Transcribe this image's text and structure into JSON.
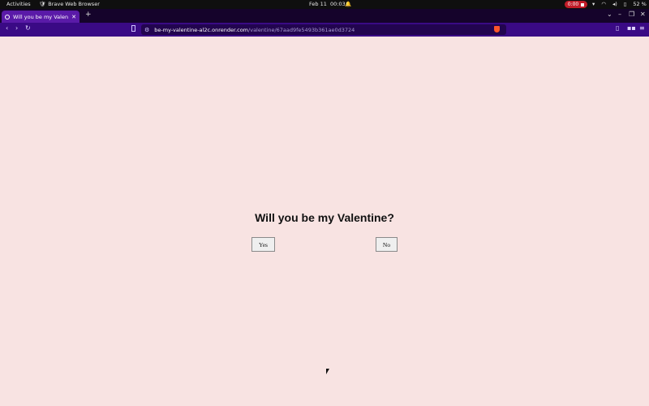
{
  "system_bar": {
    "activities": "Activities",
    "app_name": "Brave Web Browser",
    "date": "Feb 11",
    "time": "00:03",
    "recording": "0:00",
    "battery": "52 %"
  },
  "browser": {
    "tab_title": "Will you be my Valentine",
    "new_tab": "+",
    "url_host": "be-my-valentine-al2c.onrender.com",
    "url_path": "/valentine/67aad9fe5493b361ae0d3724"
  },
  "page": {
    "question": "Will you be my Valentine?",
    "yes_label": "Yes",
    "no_label": "No"
  }
}
